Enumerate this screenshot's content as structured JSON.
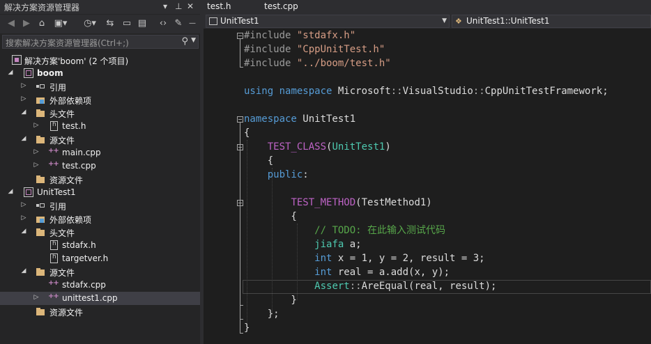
{
  "solution_explorer": {
    "title": "解决方案资源管理器",
    "title_icons": {
      "dropdown": "▾",
      "pin": "⊥",
      "close": "✕"
    },
    "search_placeholder": "搜索解决方案资源管理器(Ctrl+;)",
    "toolbar_icons": [
      "back-icon",
      "forward-icon",
      "home-icon",
      "solution-views-icon",
      "history-icon",
      "sync-icon",
      "collapse-all-icon",
      "show-all-files-icon",
      "view-code-icon",
      "properties-icon"
    ],
    "tree": [
      {
        "label": "解决方案'boom' (2 个项目)",
        "icon": "solution-icon",
        "bold": false
      },
      {
        "label": "boom",
        "icon": "project-icon",
        "bold": true
      },
      {
        "label": "引用",
        "icon": "references-icon"
      },
      {
        "label": "外部依赖项",
        "icon": "external-deps-icon"
      },
      {
        "label": "头文件",
        "icon": "folder-icon"
      },
      {
        "label": "test.h",
        "icon": "header-file-icon"
      },
      {
        "label": "源文件",
        "icon": "folder-icon"
      },
      {
        "label": "main.cpp",
        "icon": "cpp-file-icon"
      },
      {
        "label": "test.cpp",
        "icon": "cpp-file-icon"
      },
      {
        "label": "资源文件",
        "icon": "folder-icon"
      },
      {
        "label": "UnitTest1",
        "icon": "project-icon",
        "bold": false
      },
      {
        "label": "引用",
        "icon": "references-icon"
      },
      {
        "label": "外部依赖项",
        "icon": "external-deps-icon"
      },
      {
        "label": "头文件",
        "icon": "folder-icon"
      },
      {
        "label": "stdafx.h",
        "icon": "header-file-icon"
      },
      {
        "label": "targetver.h",
        "icon": "header-file-icon"
      },
      {
        "label": "源文件",
        "icon": "folder-icon"
      },
      {
        "label": "stdafx.cpp",
        "icon": "cpp-file-icon"
      },
      {
        "label": "unittest1.cpp",
        "icon": "cpp-file-icon",
        "selected": true
      },
      {
        "label": "资源文件",
        "icon": "folder-icon"
      }
    ]
  },
  "editor": {
    "tabs": [
      "test.h",
      "test.cpp"
    ],
    "nav_project": "UnitTest1",
    "nav_member": "UnitTest1::UnitTest1",
    "code_lines": [
      "#include \"stdafx.h\"",
      "#include \"CppUnitTest.h\"",
      "#include \"../boom/test.h\"",
      "",
      "using namespace Microsoft::VisualStudio::CppUnitTestFramework;",
      "",
      "namespace UnitTest1",
      "{",
      "    TEST_CLASS(UnitTest1)",
      "    {",
      "    public:",
      "",
      "        TEST_METHOD(TestMethod1)",
      "        {",
      "            // TODO: 在此输入测试代码",
      "            jiafa a;",
      "            int x = 1, y = 2, result = 3;",
      "            int real = a.add(x, y);",
      "            Assert::AreEqual(real, result);",
      "        }",
      "    };",
      "}"
    ]
  },
  "colors": {
    "keyword": "#569cd6",
    "string": "#d69d85",
    "type": "#4ec9b0",
    "macro": "#bd63c5",
    "comment": "#57a64a",
    "background": "#1e1e1e"
  }
}
